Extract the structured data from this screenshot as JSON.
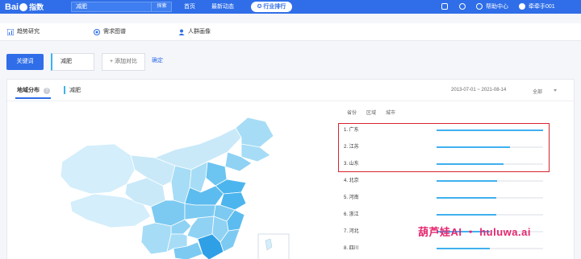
{
  "header": {
    "logo_main": "Bai",
    "logo_paw": "du",
    "logo_sub": "指数",
    "search_value": "减肥",
    "search_button": "探索",
    "nav": [
      "首页",
      "最新动态"
    ],
    "rank_button": "行业排行",
    "help_center": "帮助中心",
    "username": "牵牵手001"
  },
  "subnav": {
    "items": [
      {
        "label": "趋势研究",
        "icon": "trend-chart-icon"
      },
      {
        "label": "需求图谱",
        "icon": "radar-icon"
      },
      {
        "label": "人群画像",
        "icon": "people-icon"
      }
    ]
  },
  "query": {
    "keyword_button": "关键词",
    "keyword": "减肥",
    "add_compare": "+ 添加对比",
    "confirm": "确定"
  },
  "panel": {
    "tab": "地域分布",
    "keyword_tag": "减肥",
    "date_range": "2013-07-01 ~ 2021-08-14",
    "region_select": "全部",
    "rank_tabs": [
      "省份",
      "区域",
      "城市"
    ],
    "rankings": [
      {
        "label": "1.  广东",
        "value": 1.0
      },
      {
        "label": "2.  江苏",
        "value": 0.69
      },
      {
        "label": "3.  山东",
        "value": 0.63
      },
      {
        "label": "4.  北京",
        "value": 0.57
      },
      {
        "label": "5.  河南",
        "value": 0.56
      },
      {
        "label": "6.  浙江",
        "value": 0.56
      },
      {
        "label": "7.  河北",
        "value": 0.5
      },
      {
        "label": "8.  四川",
        "value": 0.5
      }
    ]
  },
  "watermark": "葫芦娃AI ・ huluwa.ai",
  "colors": {
    "brand": "#2f6ee8",
    "bar": "#3fb0f0",
    "highlight": "#d9232d",
    "watermark": "#e5266e"
  }
}
